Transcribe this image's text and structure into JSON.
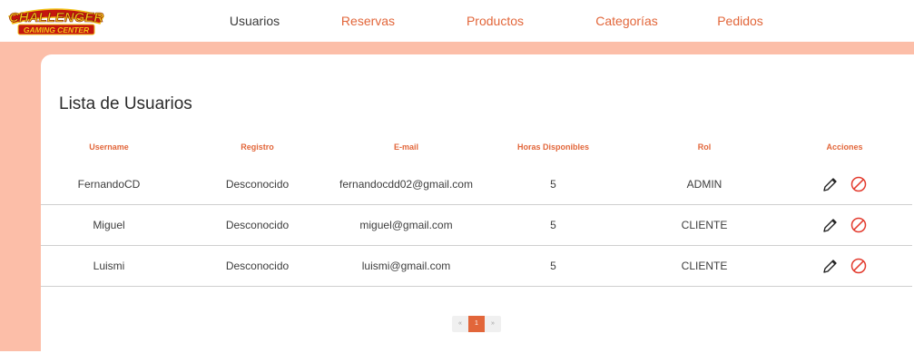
{
  "brand": {
    "logo_line1": "CHALLENGER",
    "logo_line2": "GAMING CENTER",
    "colors": {
      "accent": "#e2663a",
      "background": "#fcbea8",
      "logo_red": "#c4150f",
      "logo_yellow": "#f2c418"
    }
  },
  "nav": {
    "items": [
      {
        "label": "Usuarios",
        "active": true
      },
      {
        "label": "Reservas",
        "active": false
      },
      {
        "label": "Productos",
        "active": false
      },
      {
        "label": "Categorías",
        "active": false
      },
      {
        "label": "Pedidos",
        "active": false
      }
    ]
  },
  "main": {
    "title": "Lista de Usuarios",
    "columns": [
      "Username",
      "Registro",
      "E-mail",
      "Horas Disponibles",
      "Rol",
      "Acciones"
    ],
    "rows": [
      {
        "username": "FernandoCD",
        "registro": "Desconocido",
        "email": "fernandocdd02@gmail.com",
        "horas": "5",
        "rol": "ADMIN"
      },
      {
        "username": "Miguel",
        "registro": "Desconocido",
        "email": "miguel@gmail.com",
        "horas": "5",
        "rol": "CLIENTE"
      },
      {
        "username": "Luismi",
        "registro": "Desconocido",
        "email": "luismi@gmail.com",
        "horas": "5",
        "rol": "CLIENTE"
      }
    ],
    "row_action_icons": [
      "pencil-icon",
      "ban-icon"
    ]
  },
  "pagination": {
    "prev": "«",
    "current": "1",
    "next": "»"
  }
}
